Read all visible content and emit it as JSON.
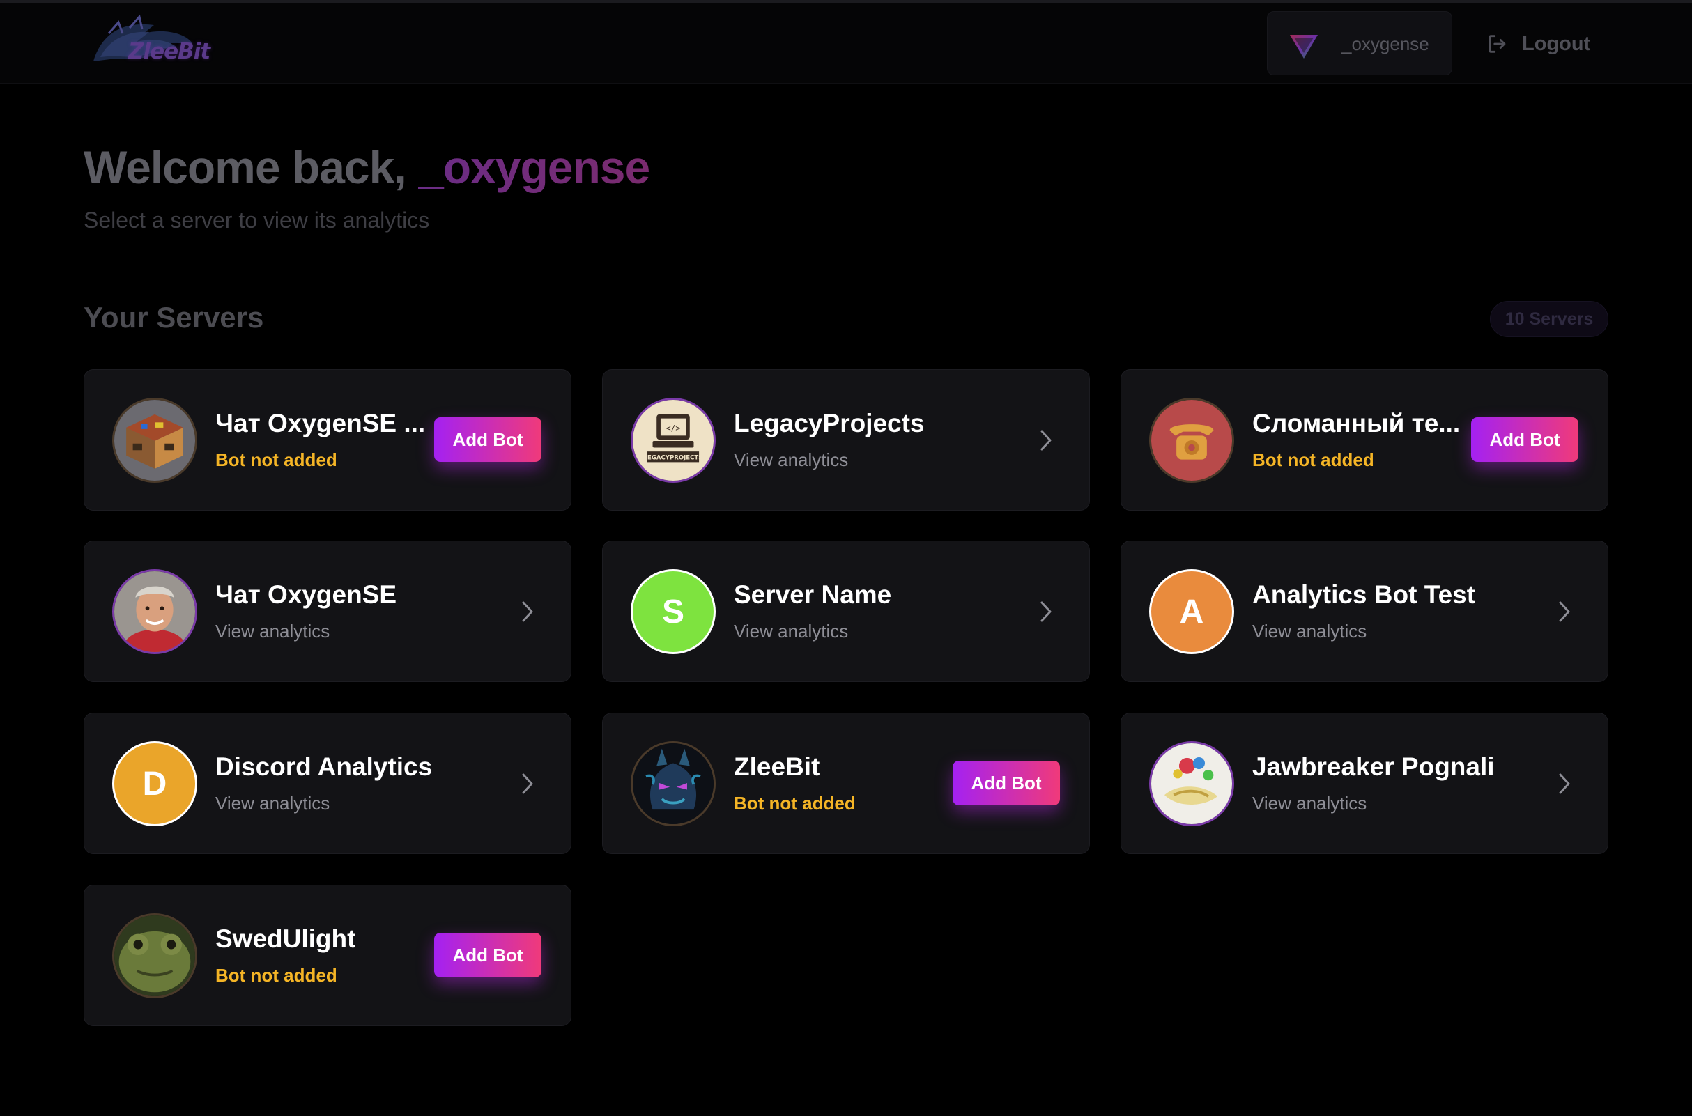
{
  "header": {
    "logo_text": "ZleeBit",
    "user_name": "_oxygense",
    "logout_label": "Logout"
  },
  "welcome": {
    "prefix": "Welcome back, ",
    "user": "_oxygense",
    "subtitle": "Select a server to view its analytics"
  },
  "servers": {
    "title": "Your Servers",
    "count_label": "10 Servers",
    "add_bot_label": "Add Bot",
    "items": [
      {
        "name": "Чат OxygenSE ...",
        "status": "Bot not added",
        "bot_added": false,
        "avatar": "minecraft-block-icon"
      },
      {
        "name": "LegacyProjects",
        "status": "View analytics",
        "bot_added": true,
        "avatar": "legacy-projects-logo"
      },
      {
        "name": "Сломанный те...",
        "status": "Bot not added",
        "bot_added": false,
        "avatar": "telephone-icon"
      },
      {
        "name": "Чат OxygenSE",
        "status": "View analytics",
        "bot_added": true,
        "avatar": "user-photo"
      },
      {
        "name": "Server Name",
        "status": "View analytics",
        "bot_added": true,
        "avatar_letter": "S",
        "avatar_color": "#7ee33f"
      },
      {
        "name": "Analytics Bot Test",
        "status": "View analytics",
        "bot_added": true,
        "avatar_letter": "A",
        "avatar_color": "#e98b3d"
      },
      {
        "name": "Discord Analytics",
        "status": "View analytics",
        "bot_added": true,
        "avatar_letter": "D",
        "avatar_color": "#eaa52a"
      },
      {
        "name": "ZleeBit",
        "status": "Bot not added",
        "bot_added": false,
        "avatar": "dragon-logo"
      },
      {
        "name": "Jawbreaker Pognali",
        "status": "View analytics",
        "bot_added": true,
        "avatar": "candy-art"
      },
      {
        "name": "SwedUlight",
        "status": "Bot not added",
        "bot_added": false,
        "avatar": "frog-photo"
      }
    ]
  },
  "colors": {
    "background": "#000000",
    "card": "#131316",
    "warning": "#f5b526",
    "accent_start": "#a421f2",
    "accent_end": "#f03a7a"
  }
}
